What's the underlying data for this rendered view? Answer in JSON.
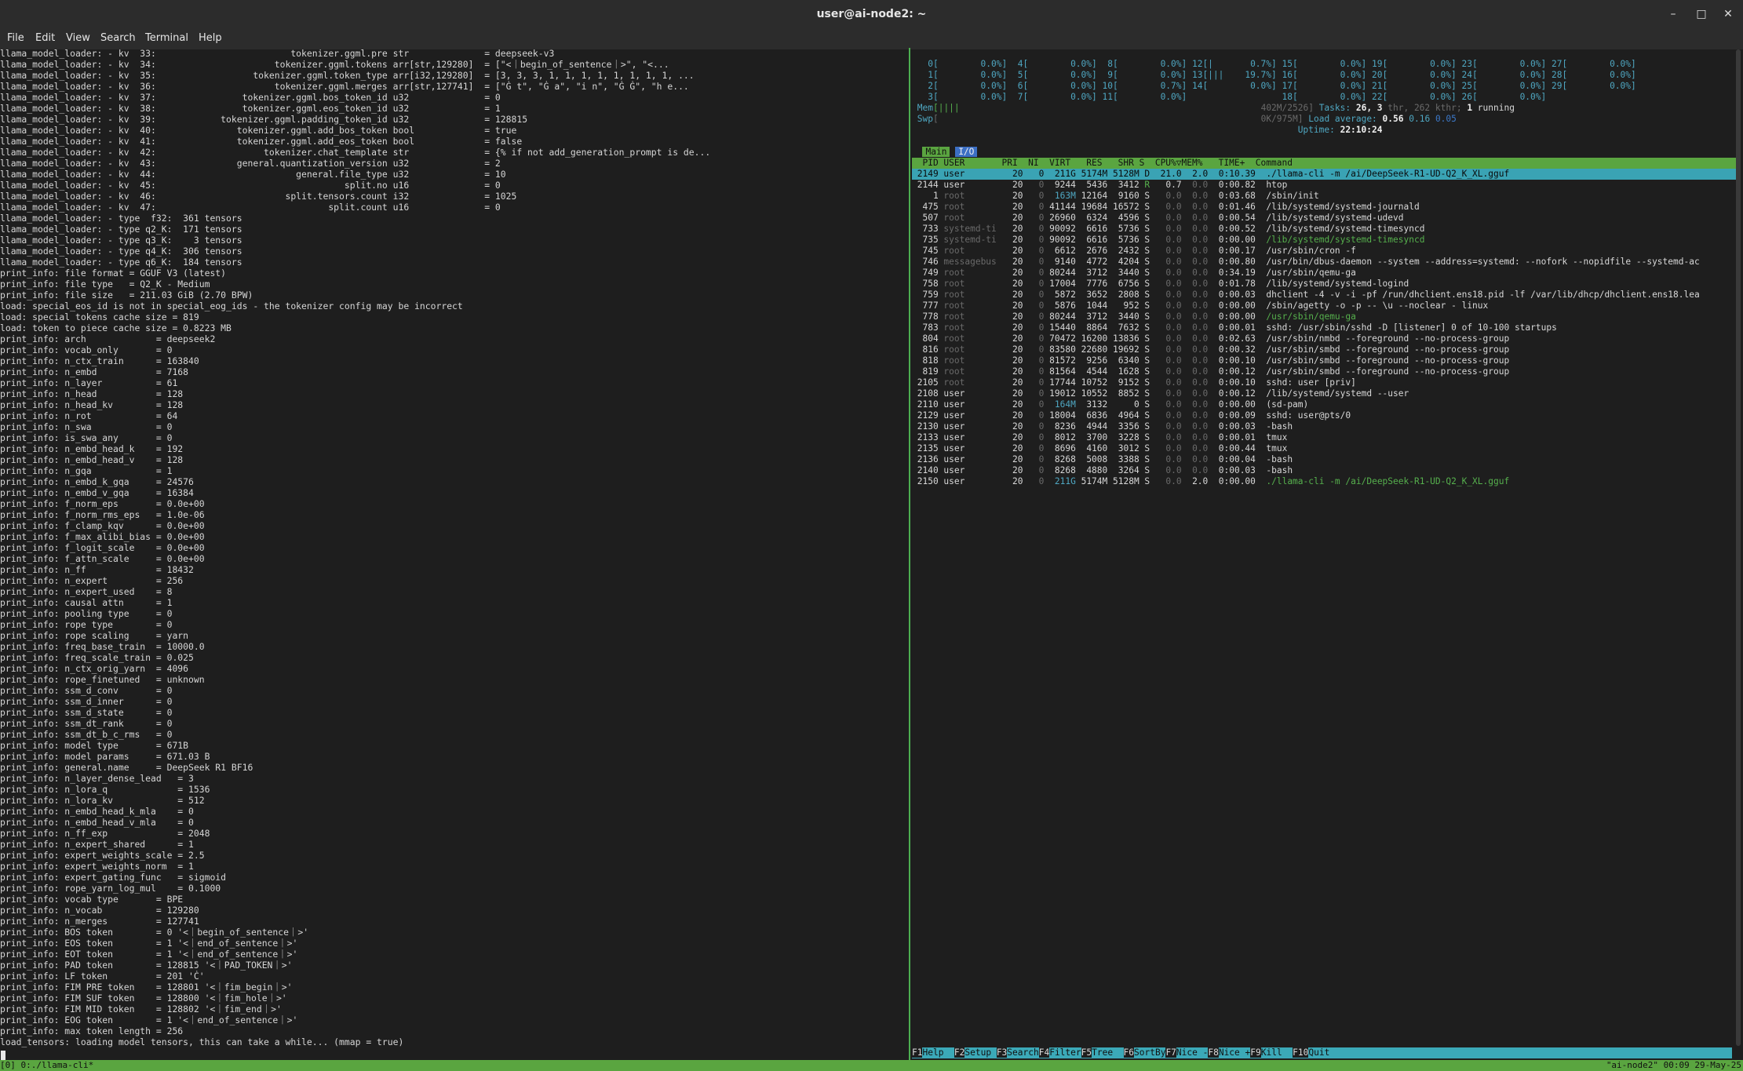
{
  "window": {
    "title": "user@ai-node2: ~"
  },
  "menu": [
    "File",
    "Edit",
    "View",
    "Search",
    "Terminal",
    "Help"
  ],
  "left_lines": [
    "llama_model_loader: - kv  33:                         tokenizer.ggml.pre str              = deepseek-v3",
    "llama_model_loader: - kv  34:                      tokenizer.ggml.tokens arr[str,129280]  = [\"<｜begin_of_sentence｜>\", \"<...",
    "llama_model_loader: - kv  35:                  tokenizer.ggml.token_type arr[i32,129280]  = [3, 3, 3, 1, 1, 1, 1, 1, 1, 1, 1, ...",
    "llama_model_loader: - kv  36:                      tokenizer.ggml.merges arr[str,127741]  = [\"Ġ t\", \"Ġ a\", \"i n\", \"Ġ Ġ\", \"h e...",
    "llama_model_loader: - kv  37:                tokenizer.ggml.bos_token_id u32              = 0",
    "llama_model_loader: - kv  38:                tokenizer.ggml.eos_token_id u32              = 1",
    "llama_model_loader: - kv  39:            tokenizer.ggml.padding_token_id u32              = 128815",
    "llama_model_loader: - kv  40:               tokenizer.ggml.add_bos_token bool             = true",
    "llama_model_loader: - kv  41:               tokenizer.ggml.add_eos_token bool             = false",
    "llama_model_loader: - kv  42:                    tokenizer.chat_template str              = {% if not add_generation_prompt is de...",
    "llama_model_loader: - kv  43:               general.quantization_version u32              = 2",
    "llama_model_loader: - kv  44:                          general.file_type u32              = 10",
    "llama_model_loader: - kv  45:                                   split.no u16              = 0",
    "llama_model_loader: - kv  46:                        split.tensors.count i32              = 1025",
    "llama_model_loader: - kv  47:                                split.count u16              = 0",
    "llama_model_loader: - type  f32:  361 tensors",
    "llama_model_loader: - type q2_K:  171 tensors",
    "llama_model_loader: - type q3_K:    3 tensors",
    "llama_model_loader: - type q4_K:  306 tensors",
    "llama_model_loader: - type q6_K:  184 tensors",
    "print_info: file format = GGUF V3 (latest)",
    "print_info: file type   = Q2_K - Medium",
    "print_info: file size   = 211.03 GiB (2.70 BPW)",
    "load: special_eos_id is not in special_eog_ids - the tokenizer config may be incorrect",
    "load: special tokens cache size = 819",
    "load: token to piece cache size = 0.8223 MB",
    "print_info: arch             = deepseek2",
    "print_info: vocab_only       = 0",
    "print_info: n_ctx_train      = 163840",
    "print_info: n_embd           = 7168",
    "print_info: n_layer          = 61",
    "print_info: n_head           = 128",
    "print_info: n_head_kv        = 128",
    "print_info: n_rot            = 64",
    "print_info: n_swa            = 0",
    "print_info: is_swa_any       = 0",
    "print_info: n_embd_head_k    = 192",
    "print_info: n_embd_head_v    = 128",
    "print_info: n_gqa            = 1",
    "print_info: n_embd_k_gqa     = 24576",
    "print_info: n_embd_v_gqa     = 16384",
    "print_info: f_norm_eps       = 0.0e+00",
    "print_info: f_norm_rms_eps   = 1.0e-06",
    "print_info: f_clamp_kqv      = 0.0e+00",
    "print_info: f_max_alibi_bias = 0.0e+00",
    "print_info: f_logit_scale    = 0.0e+00",
    "print_info: f_attn_scale     = 0.0e+00",
    "print_info: n_ff             = 18432",
    "print_info: n_expert         = 256",
    "print_info: n_expert_used    = 8",
    "print_info: causal attn      = 1",
    "print_info: pooling type     = 0",
    "print_info: rope type        = 0",
    "print_info: rope scaling     = yarn",
    "print_info: freq_base_train  = 10000.0",
    "print_info: freq_scale_train = 0.025",
    "print_info: n_ctx_orig_yarn  = 4096",
    "print_info: rope_finetuned   = unknown",
    "print_info: ssm_d_conv       = 0",
    "print_info: ssm_d_inner      = 0",
    "print_info: ssm_d_state      = 0",
    "print_info: ssm_dt_rank      = 0",
    "print_info: ssm_dt_b_c_rms   = 0",
    "print_info: model type       = 671B",
    "print_info: model params     = 671.03 B",
    "print_info: general.name     = DeepSeek R1 BF16",
    "print_info: n_layer_dense_lead   = 3",
    "print_info: n_lora_q             = 1536",
    "print_info: n_lora_kv            = 512",
    "print_info: n_embd_head_k_mla    = 0",
    "print_info: n_embd_head_v_mla    = 0",
    "print_info: n_ff_exp             = 2048",
    "print_info: n_expert_shared      = 1",
    "print_info: expert_weights_scale = 2.5",
    "print_info: expert_weights_norm  = 1",
    "print_info: expert_gating_func   = sigmoid",
    "print_info: rope_yarn_log_mul    = 0.1000",
    "print_info: vocab type       = BPE",
    "print_info: n_vocab          = 129280",
    "print_info: n_merges         = 127741",
    "print_info: BOS token        = 0 '<｜begin_of_sentence｜>'",
    "print_info: EOS token        = 1 '<｜end_of_sentence｜>'",
    "print_info: EOT token        = 1 '<｜end_of_sentence｜>'",
    "print_info: PAD token        = 128815 '<｜PAD_TOKEN｜>'",
    "print_info: LF token         = 201 'Ċ'",
    "print_info: FIM PRE token    = 128801 '<｜fim_begin｜>'",
    "print_info: FIM SUF token    = 128800 '<｜fim_hole｜>'",
    "print_info: FIM MID token    = 128802 '<｜fim_end｜>'",
    "print_info: EOG token        = 1 '<｜end_of_sentence｜>'",
    "print_info: max token length = 256",
    "load_tensors: loading model tensors, this can take a while... (mmap = true)"
  ],
  "htop": {
    "cpu_rows": [
      "   0[        0.0%]  4[        0.0%]  8[        0.0%] 12[|       0.7%] 15[        0.0%] 19[        0.0%] 23[        0.0%] 27[        0.0%]",
      "   1[        0.0%]  5[        0.0%]  9[        0.0%] 13[|||    19.7%] 16[        0.0%] 20[        0.0%] 24[        0.0%] 28[        0.0%]",
      "   2[        0.0%]  6[        0.0%] 10[        0.7%] 14[        0.0%] 17[        0.0%] 21[        0.0%] 25[        0.0%] 29[        0.0%]",
      "   3[        0.0%]  7[        0.0%] 11[        0.0%]                  18[        0.0%] 22[        0.0%] 26[        0.0%]"
    ],
    "mem_label": "Mem",
    "mem_bar": "[||||",
    "mem_value": "402M/2526]",
    "swp_label": "Swp",
    "swp_bar": "[",
    "swp_value": "0K/975M]",
    "tasks_label": "Tasks: ",
    "tasks_value": "26, 3",
    "tasks_thr": " thr, 262 kthr; ",
    "running_num": "1",
    "running_label": " running",
    "load_label": "Load average: ",
    "load_1": "0.56",
    "load_5": "0.16",
    "load_15": "0.05",
    "uptime_label": "Uptime: ",
    "uptime_value": "22:10:24",
    "tab_main": "Main",
    "tab_io": "I/O",
    "header": "  PID USER       PRI  NI  VIRT   RES   SHR S  CPU%▽MEM%   TIME+  Command",
    "processes": [
      {
        "pid": "2149",
        "user": "user",
        "pri": "20",
        "ni": "0",
        "virt": "211G",
        "res": "5174M",
        "shr": "5128M",
        "s": "D",
        "cpu": "21.0",
        "mem": "2.0",
        "time": "0:10.39",
        "cmd": "./llama-cli -m /ai/DeepSeek-R1-UD-Q2_K_XL.gguf",
        "sel": true
      },
      {
        "pid": "2144",
        "user": "user",
        "pri": "20",
        "ni": "0",
        "virt": "9244",
        "res": "5436",
        "shr": "3412",
        "s": "R",
        "cpu": "0.7",
        "mem": "0.0",
        "time": "0:00.82",
        "cmd": "htop"
      },
      {
        "pid": "1",
        "user": "root",
        "pri": "20",
        "ni": "0",
        "virt": "163M",
        "res": "12164",
        "shr": "9160",
        "s": "S",
        "cpu": "0.0",
        "mem": "0.0",
        "time": "0:03.68",
        "cmd": "/sbin/init"
      },
      {
        "pid": "475",
        "user": "root",
        "pri": "20",
        "ni": "0",
        "virt": "41144",
        "res": "19684",
        "shr": "16572",
        "s": "S",
        "cpu": "0.0",
        "mem": "0.0",
        "time": "0:01.46",
        "cmd": "/lib/systemd/systemd-journald"
      },
      {
        "pid": "507",
        "user": "root",
        "pri": "20",
        "ni": "0",
        "virt": "26960",
        "res": "6324",
        "shr": "4596",
        "s": "S",
        "cpu": "0.0",
        "mem": "0.0",
        "time": "0:00.54",
        "cmd": "/lib/systemd/systemd-udevd"
      },
      {
        "pid": "733",
        "user": "systemd-ti",
        "pri": "20",
        "ni": "0",
        "virt": "90092",
        "res": "6616",
        "shr": "5736",
        "s": "S",
        "cpu": "0.0",
        "mem": "0.0",
        "time": "0:00.52",
        "cmd": "/lib/systemd/systemd-timesyncd"
      },
      {
        "pid": "735",
        "user": "systemd-ti",
        "pri": "20",
        "ni": "0",
        "virt": "90092",
        "res": "6616",
        "shr": "5736",
        "s": "S",
        "cpu": "0.0",
        "mem": "0.0",
        "time": "0:00.00",
        "cmd": "/lib/systemd/systemd-timesyncd",
        "green": true
      },
      {
        "pid": "745",
        "user": "root",
        "pri": "20",
        "ni": "0",
        "virt": "6612",
        "res": "2676",
        "shr": "2432",
        "s": "S",
        "cpu": "0.0",
        "mem": "0.0",
        "time": "0:00.17",
        "cmd": "/usr/sbin/cron -f"
      },
      {
        "pid": "746",
        "user": "messagebus",
        "pri": "20",
        "ni": "0",
        "virt": "9140",
        "res": "4772",
        "shr": "4204",
        "s": "S",
        "cpu": "0.0",
        "mem": "0.0",
        "time": "0:00.80",
        "cmd": "/usr/bin/dbus-daemon --system --address=systemd: --nofork --nopidfile --systemd-ac"
      },
      {
        "pid": "749",
        "user": "root",
        "pri": "20",
        "ni": "0",
        "virt": "80244",
        "res": "3712",
        "shr": "3440",
        "s": "S",
        "cpu": "0.0",
        "mem": "0.0",
        "time": "0:34.19",
        "cmd": "/usr/sbin/qemu-ga"
      },
      {
        "pid": "758",
        "user": "root",
        "pri": "20",
        "ni": "0",
        "virt": "17004",
        "res": "7776",
        "shr": "6756",
        "s": "S",
        "cpu": "0.0",
        "mem": "0.0",
        "time": "0:01.78",
        "cmd": "/lib/systemd/systemd-logind"
      },
      {
        "pid": "759",
        "user": "root",
        "pri": "20",
        "ni": "0",
        "virt": "5872",
        "res": "3652",
        "shr": "2808",
        "s": "S",
        "cpu": "0.0",
        "mem": "0.0",
        "time": "0:00.03",
        "cmd": "dhclient -4 -v -i -pf /run/dhclient.ens18.pid -lf /var/lib/dhcp/dhclient.ens18.lea"
      },
      {
        "pid": "777",
        "user": "root",
        "pri": "20",
        "ni": "0",
        "virt": "5876",
        "res": "1044",
        "shr": "952",
        "s": "S",
        "cpu": "0.0",
        "mem": "0.0",
        "time": "0:00.00",
        "cmd": "/sbin/agetty -o -p -- \\u --noclear - linux"
      },
      {
        "pid": "778",
        "user": "root",
        "pri": "20",
        "ni": "0",
        "virt": "80244",
        "res": "3712",
        "shr": "3440",
        "s": "S",
        "cpu": "0.0",
        "mem": "0.0",
        "time": "0:00.00",
        "cmd": "/usr/sbin/qemu-ga",
        "green": true
      },
      {
        "pid": "783",
        "user": "root",
        "pri": "20",
        "ni": "0",
        "virt": "15440",
        "res": "8864",
        "shr": "7632",
        "s": "S",
        "cpu": "0.0",
        "mem": "0.0",
        "time": "0:00.01",
        "cmd": "sshd: /usr/sbin/sshd -D [listener] 0 of 10-100 startups"
      },
      {
        "pid": "804",
        "user": "root",
        "pri": "20",
        "ni": "0",
        "virt": "70472",
        "res": "16200",
        "shr": "13836",
        "s": "S",
        "cpu": "0.0",
        "mem": "0.0",
        "time": "0:02.63",
        "cmd": "/usr/sbin/nmbd --foreground --no-process-group"
      },
      {
        "pid": "816",
        "user": "root",
        "pri": "20",
        "ni": "0",
        "virt": "83580",
        "res": "22680",
        "shr": "19692",
        "s": "S",
        "cpu": "0.0",
        "mem": "0.0",
        "time": "0:00.32",
        "cmd": "/usr/sbin/smbd --foreground --no-process-group"
      },
      {
        "pid": "818",
        "user": "root",
        "pri": "20",
        "ni": "0",
        "virt": "81572",
        "res": "9256",
        "shr": "6340",
        "s": "S",
        "cpu": "0.0",
        "mem": "0.0",
        "time": "0:00.10",
        "cmd": "/usr/sbin/smbd --foreground --no-process-group"
      },
      {
        "pid": "819",
        "user": "root",
        "pri": "20",
        "ni": "0",
        "virt": "81564",
        "res": "4544",
        "shr": "1628",
        "s": "S",
        "cpu": "0.0",
        "mem": "0.0",
        "time": "0:00.12",
        "cmd": "/usr/sbin/smbd --foreground --no-process-group"
      },
      {
        "pid": "2105",
        "user": "root",
        "pri": "20",
        "ni": "0",
        "virt": "17744",
        "res": "10752",
        "shr": "9152",
        "s": "S",
        "cpu": "0.0",
        "mem": "0.0",
        "time": "0:00.10",
        "cmd": "sshd: user [priv]"
      },
      {
        "pid": "2108",
        "user": "user",
        "pri": "20",
        "ni": "0",
        "virt": "19012",
        "res": "10552",
        "shr": "8852",
        "s": "S",
        "cpu": "0.0",
        "mem": "0.0",
        "time": "0:00.12",
        "cmd": "/lib/systemd/systemd --user"
      },
      {
        "pid": "2110",
        "user": "user",
        "pri": "20",
        "ni": "0",
        "virt": "164M",
        "res": "3132",
        "shr": "0",
        "s": "S",
        "cpu": "0.0",
        "mem": "0.0",
        "time": "0:00.00",
        "cmd": "(sd-pam)"
      },
      {
        "pid": "2129",
        "user": "user",
        "pri": "20",
        "ni": "0",
        "virt": "18004",
        "res": "6836",
        "shr": "4964",
        "s": "S",
        "cpu": "0.0",
        "mem": "0.0",
        "time": "0:00.09",
        "cmd": "sshd: user@pts/0"
      },
      {
        "pid": "2130",
        "user": "user",
        "pri": "20",
        "ni": "0",
        "virt": "8236",
        "res": "4944",
        "shr": "3356",
        "s": "S",
        "cpu": "0.0",
        "mem": "0.0",
        "time": "0:00.03",
        "cmd": "-bash"
      },
      {
        "pid": "2133",
        "user": "user",
        "pri": "20",
        "ni": "0",
        "virt": "8012",
        "res": "3700",
        "shr": "3228",
        "s": "S",
        "cpu": "0.0",
        "mem": "0.0",
        "time": "0:00.01",
        "cmd": "tmux"
      },
      {
        "pid": "2135",
        "user": "user",
        "pri": "20",
        "ni": "0",
        "virt": "8696",
        "res": "4160",
        "shr": "3012",
        "s": "S",
        "cpu": "0.0",
        "mem": "0.0",
        "time": "0:00.44",
        "cmd": "tmux"
      },
      {
        "pid": "2136",
        "user": "user",
        "pri": "20",
        "ni": "0",
        "virt": "8268",
        "res": "5008",
        "shr": "3388",
        "s": "S",
        "cpu": "0.0",
        "mem": "0.0",
        "time": "0:00.04",
        "cmd": "-bash"
      },
      {
        "pid": "2140",
        "user": "user",
        "pri": "20",
        "ni": "0",
        "virt": "8268",
        "res": "4880",
        "shr": "3264",
        "s": "S",
        "cpu": "0.0",
        "mem": "0.0",
        "time": "0:00.03",
        "cmd": "-bash"
      },
      {
        "pid": "2150",
        "user": "user",
        "pri": "20",
        "ni": "0",
        "virt": "211G",
        "res": "5174M",
        "shr": "5128M",
        "s": "S",
        "cpu": "0.0",
        "mem": "2.0",
        "time": "0:00.00",
        "cmd": "./llama-cli -m /ai/DeepSeek-R1-UD-Q2_K_XL.gguf",
        "green": true
      }
    ],
    "fkeys": [
      {
        "key": "F1",
        "label": "Help  "
      },
      {
        "key": "F2",
        "label": "Setup "
      },
      {
        "key": "F3",
        "label": "Search"
      },
      {
        "key": "F4",
        "label": "Filter"
      },
      {
        "key": "F5",
        "label": "Tree  "
      },
      {
        "key": "F6",
        "label": "SortBy"
      },
      {
        "key": "F7",
        "label": "Nice -"
      },
      {
        "key": "F8",
        "label": "Nice +"
      },
      {
        "key": "F9",
        "label": "Kill  "
      },
      {
        "key": "F10",
        "label": "Quit  "
      }
    ]
  },
  "tmux": {
    "left": "[0] 0:./llama-cli*",
    "right": "\"ai-node2\" 00:09 29-May-25"
  }
}
